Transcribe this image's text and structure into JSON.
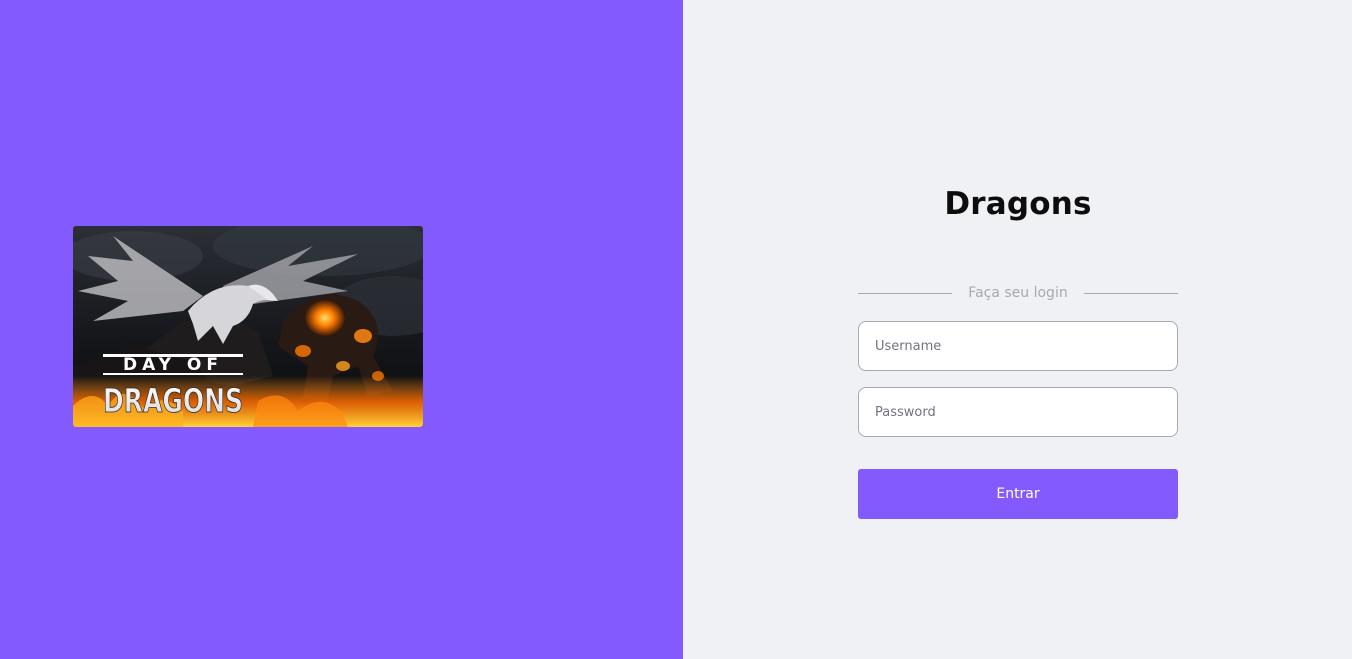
{
  "app": {
    "title": "Dragons"
  },
  "hero": {
    "line1": "DAY OF",
    "line2": "DRAGONS"
  },
  "login": {
    "separator_label": "Faça seu login",
    "username_placeholder": "Username",
    "password_placeholder": "Password",
    "submit_label": "Entrar"
  },
  "colors": {
    "accent": "#835afd",
    "panel_background": "#f0f1f5",
    "separator": "#a8a8b3"
  }
}
